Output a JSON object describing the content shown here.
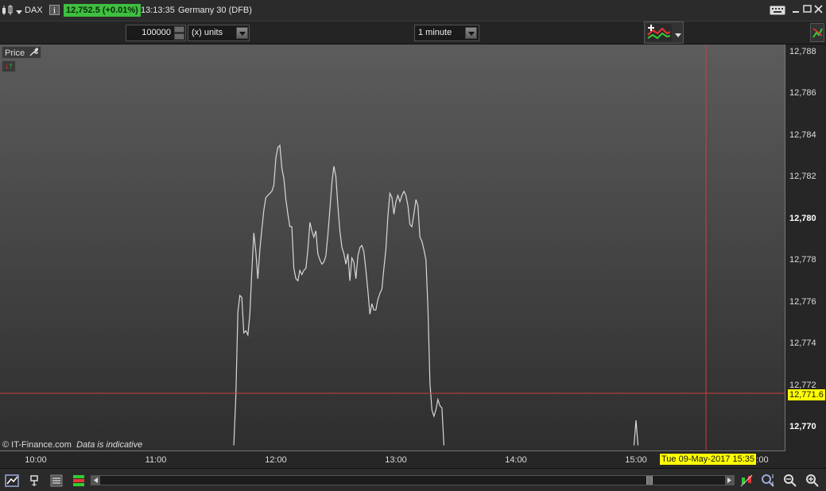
{
  "titlebar": {
    "instrument": "DAX",
    "price_badge": "12,752.5 (+0.01%)",
    "time": "13:13:35",
    "market_name": "Germany 30 (DFB)"
  },
  "toolbar": {
    "quantity": "100000",
    "unit_select": "(x) units",
    "interval_select": "1 minute"
  },
  "panel": {
    "price_label": "Price"
  },
  "axes": {
    "y_ticks": [
      {
        "label": "12,788",
        "bold": false
      },
      {
        "label": "12,786",
        "bold": false
      },
      {
        "label": "12,784",
        "bold": false
      },
      {
        "label": "12,782",
        "bold": false
      },
      {
        "label": "12,780",
        "bold": true
      },
      {
        "label": "12,778",
        "bold": false
      },
      {
        "label": "12,776",
        "bold": false
      },
      {
        "label": "12,774",
        "bold": false
      },
      {
        "label": "12,772",
        "bold": false
      },
      {
        "label": "12,770",
        "bold": true
      }
    ],
    "x_ticks": [
      "10:00",
      "11:00",
      "12:00",
      "13:00",
      "14:00",
      "15:00",
      ":00"
    ],
    "crosshair_price": "12,771.6",
    "crosshair_time": "Tue 09-May-2017 15:35"
  },
  "chart_data": {
    "type": "line",
    "x_unit": "time",
    "y_unit": "price",
    "ylim": [
      12769.1,
      12788.3
    ],
    "xlim": [
      "09:45",
      "15:15"
    ],
    "series": [
      {
        "color": "#d8d8d8",
        "points": [
          [
            "11:39",
            12769.1
          ],
          [
            "11:40",
            12771.5
          ],
          [
            "11:41",
            12775.5
          ],
          [
            "11:42",
            12776.3
          ],
          [
            "11:43",
            12776.2
          ],
          [
            "11:44",
            12774.5
          ],
          [
            "11:45",
            12774.6
          ],
          [
            "11:46",
            12774.4
          ],
          [
            "11:47",
            12775.4
          ],
          [
            "11:48",
            12777.5
          ],
          [
            "11:49",
            12779.3
          ],
          [
            "11:50",
            12778.4
          ],
          [
            "11:51",
            12777.1
          ],
          [
            "11:52",
            12778.5
          ],
          [
            "11:53",
            12779.5
          ],
          [
            "11:54",
            12780.4
          ],
          [
            "11:55",
            12781.0
          ],
          [
            "11:56",
            12781.1
          ],
          [
            "11:57",
            12781.2
          ],
          [
            "11:58",
            12781.3
          ],
          [
            "11:59",
            12781.6
          ],
          [
            "12:00",
            12782.9
          ],
          [
            "12:01",
            12783.4
          ],
          [
            "12:02",
            12783.5
          ],
          [
            "12:03",
            12782.4
          ],
          [
            "12:04",
            12781.9
          ],
          [
            "12:05",
            12780.9
          ],
          [
            "12:06",
            12780.2
          ],
          [
            "12:07",
            12779.6
          ],
          [
            "12:08",
            12779.6
          ],
          [
            "12:09",
            12777.6
          ],
          [
            "12:10",
            12777.1
          ],
          [
            "12:11",
            12777.0
          ],
          [
            "12:12",
            12777.5
          ],
          [
            "12:13",
            12777.3
          ],
          [
            "12:14",
            12777.5
          ],
          [
            "12:15",
            12777.6
          ],
          [
            "12:16",
            12778.5
          ],
          [
            "12:17",
            12779.8
          ],
          [
            "12:18",
            12779.4
          ],
          [
            "12:19",
            12779.1
          ],
          [
            "12:20",
            12779.4
          ],
          [
            "12:21",
            12778.3
          ],
          [
            "12:22",
            12778.0
          ],
          [
            "12:23",
            12777.8
          ],
          [
            "12:24",
            12777.9
          ],
          [
            "12:25",
            12778.2
          ],
          [
            "12:26",
            12779.2
          ],
          [
            "12:27",
            12780.4
          ],
          [
            "12:28",
            12781.7
          ],
          [
            "12:29",
            12782.5
          ],
          [
            "12:30",
            12782.0
          ],
          [
            "12:31",
            12780.6
          ],
          [
            "12:32",
            12779.4
          ],
          [
            "12:33",
            12778.6
          ],
          [
            "12:34",
            12778.3
          ],
          [
            "12:35",
            12777.8
          ],
          [
            "12:36",
            12778.3
          ],
          [
            "12:37",
            12777.0
          ],
          [
            "12:38",
            12778.1
          ],
          [
            "12:39",
            12777.9
          ],
          [
            "12:40",
            12777.1
          ],
          [
            "12:41",
            12778.2
          ],
          [
            "12:42",
            12778.6
          ],
          [
            "12:43",
            12778.7
          ],
          [
            "12:44",
            12778.4
          ],
          [
            "12:45",
            12777.5
          ],
          [
            "12:46",
            12776.5
          ],
          [
            "12:47",
            12775.4
          ],
          [
            "12:48",
            12775.9
          ],
          [
            "12:49",
            12775.6
          ],
          [
            "12:50",
            12775.6
          ],
          [
            "12:51",
            12776.1
          ],
          [
            "12:52",
            12776.4
          ],
          [
            "12:53",
            12776.6
          ],
          [
            "12:54",
            12777.6
          ],
          [
            "12:55",
            12778.5
          ],
          [
            "12:56",
            12780.1
          ],
          [
            "12:57",
            12781.2
          ],
          [
            "12:58",
            12781.0
          ],
          [
            "12:59",
            12780.2
          ],
          [
            "13:00",
            12780.8
          ],
          [
            "13:01",
            12781.1
          ],
          [
            "13:02",
            12780.8
          ],
          [
            "13:03",
            12781.1
          ],
          [
            "13:04",
            12781.3
          ],
          [
            "13:05",
            12781.1
          ],
          [
            "13:06",
            12780.6
          ],
          [
            "13:07",
            12779.7
          ],
          [
            "13:08",
            12779.6
          ],
          [
            "13:09",
            12780.2
          ],
          [
            "13:10",
            12780.9
          ],
          [
            "13:11",
            12780.6
          ],
          [
            "13:12",
            12779.1
          ],
          [
            "13:13",
            12778.9
          ],
          [
            "13:14",
            12778.5
          ],
          [
            "13:15",
            12778.0
          ],
          [
            "13:16",
            12775.7
          ],
          [
            "13:17",
            12772.1
          ],
          [
            "13:18",
            12770.8
          ],
          [
            "13:19",
            12770.5
          ],
          [
            "13:20",
            12770.8
          ],
          [
            "13:21",
            12771.3
          ],
          [
            "13:22",
            12771.0
          ],
          [
            "13:23",
            12770.9
          ],
          [
            "13:24",
            12769.1
          ]
        ]
      },
      {
        "color": "#d8d8d8",
        "points": [
          [
            "14:59",
            12769.1
          ],
          [
            "15:00",
            12770.3
          ],
          [
            "15:01",
            12769.1
          ]
        ]
      }
    ],
    "grid": false
  }
}
